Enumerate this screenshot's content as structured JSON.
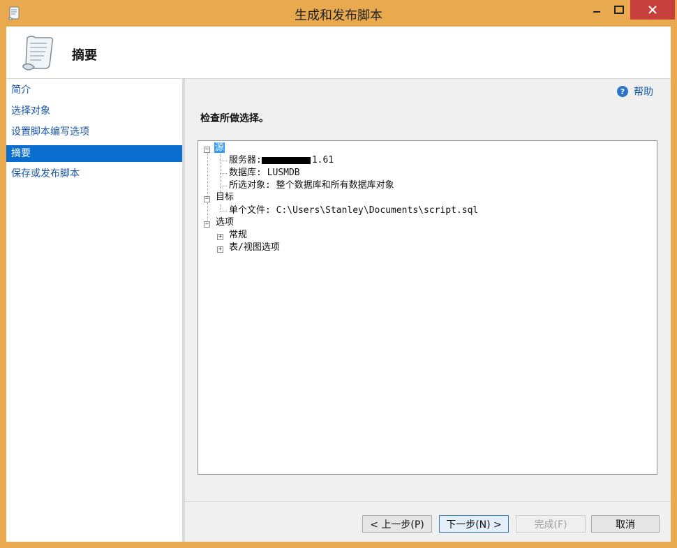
{
  "window": {
    "title": "生成和发布脚本",
    "minimize_icon": "minimize-icon",
    "maximize_icon": "maximize-icon",
    "close_icon": "close-icon",
    "frame_color": "#e9a94f",
    "close_color": "#c8403e"
  },
  "header": {
    "title": "摘要",
    "icon": "script-scroll-icon"
  },
  "nav": {
    "items": [
      {
        "label": "简介"
      },
      {
        "label": "选择对象"
      },
      {
        "label": "设置脚本编写选项"
      },
      {
        "label": "摘要"
      },
      {
        "label": "保存或发布脚本"
      }
    ],
    "active_index": 3,
    "accent": "#0a6dd0"
  },
  "content": {
    "help_label": "帮助",
    "help_icon": "help-icon",
    "section_title": "检查所做选择。"
  },
  "tree": {
    "source": {
      "label": "源",
      "server_label": "服务器:",
      "server_value": "1.61",
      "database": "数据库: LUSMDB",
      "selected_objects": "所选对象: 整个数据库和所有数据库对象"
    },
    "target": {
      "label": "目标",
      "single_file": "单个文件: C:\\Users\\Stanley\\Documents\\script.sql"
    },
    "options": {
      "label": "选项",
      "general": "常规",
      "table_view": "表/视图选项"
    }
  },
  "buttons": {
    "back": "< 上一步(P)",
    "next": "下一步(N) >",
    "finish": "完成(F)",
    "cancel": "取消"
  }
}
